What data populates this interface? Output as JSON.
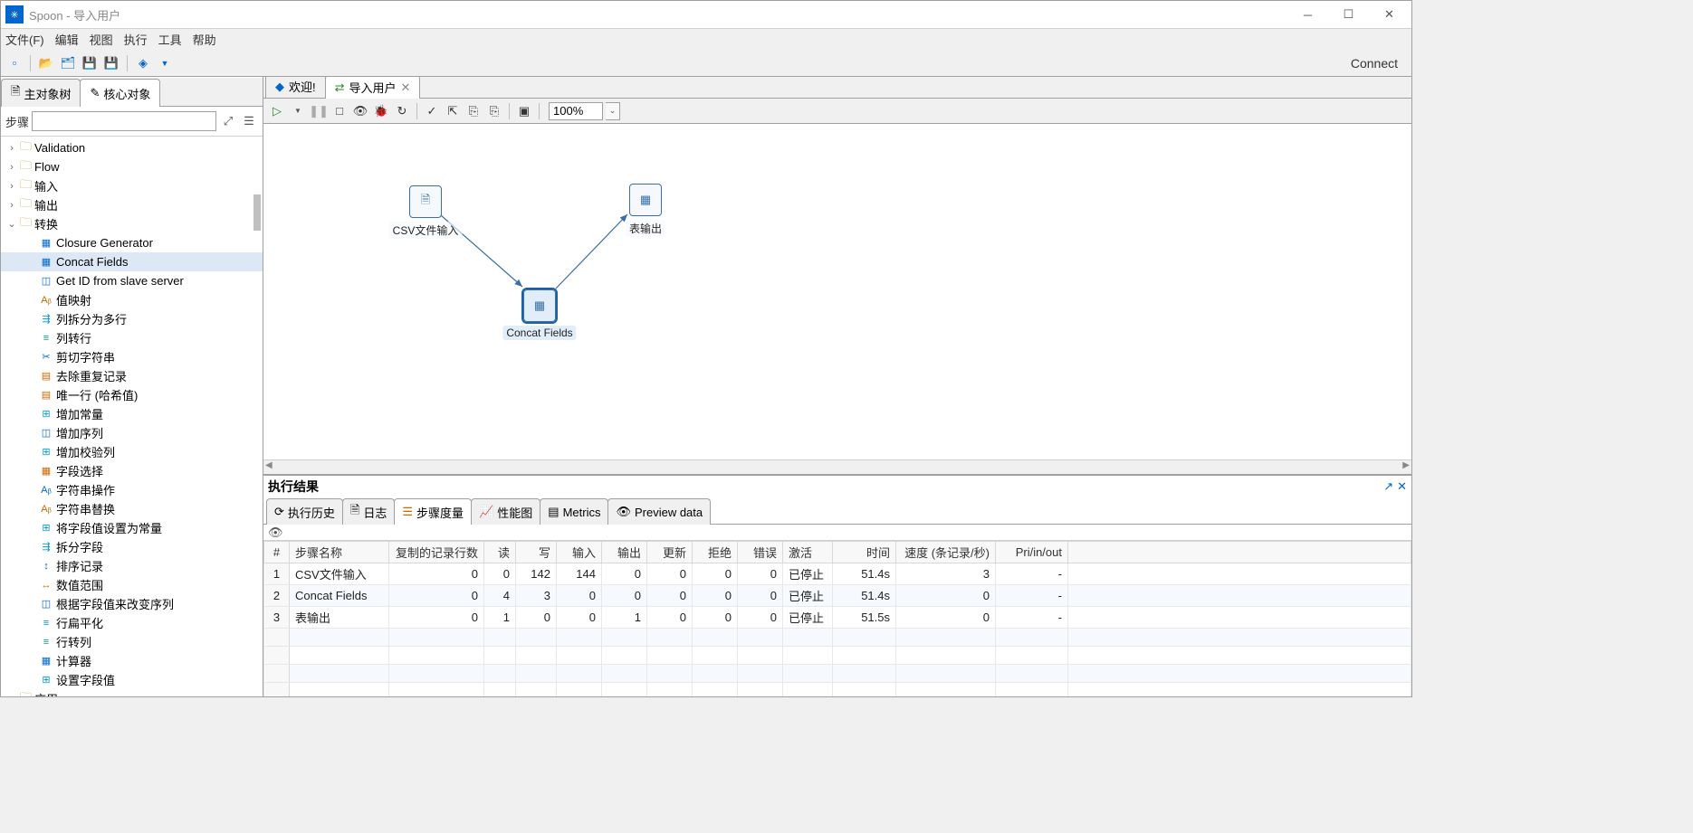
{
  "title": "Spoon - 导入用户",
  "menubar": [
    "文件(F)",
    "编辑",
    "视图",
    "执行",
    "工具",
    "帮助"
  ],
  "toolbar": {
    "connect": "Connect"
  },
  "side_tabs": {
    "main": "主对象树",
    "core": "核心对象"
  },
  "search_label": "步骤",
  "tree": {
    "validation": "Validation",
    "flow": "Flow",
    "input": "输入",
    "output": "输出",
    "transform": "转换",
    "children": [
      "Closure Generator",
      "Concat Fields",
      "Get ID from slave server",
      "值映射",
      "列拆分为多行",
      "列转行",
      "剪切字符串",
      "去除重复记录",
      "唯一行 (哈希值)",
      "增加常量",
      "增加序列",
      "增加校验列",
      "字段选择",
      "字符串操作",
      "字符串替换",
      "将字段值设置为常量",
      "拆分字段",
      "排序记录",
      "数值范围",
      "根据字段值来改变序列",
      "行扁平化",
      "行转列",
      "计算器",
      "设置字段值"
    ],
    "app": "应用"
  },
  "editor_tabs": {
    "welcome": "欢迎!",
    "import": "导入用户"
  },
  "zoom": "100%",
  "canvas": {
    "csv": "CSV文件输入",
    "concat": "Concat Fields",
    "out": "表输出"
  },
  "results": {
    "title": "执行结果",
    "tabs": {
      "hist": "执行历史",
      "log": "日志",
      "step": "步骤度量",
      "perf": "性能图",
      "metrics": "Metrics",
      "preview": "Preview data"
    },
    "cols": [
      "#",
      "步骤名称",
      "复制的记录行数",
      "读",
      "写",
      "输入",
      "输出",
      "更新",
      "拒绝",
      "错误",
      "激活",
      "时间",
      "速度 (条记录/秒)",
      "Pri/in/out"
    ],
    "rows": [
      {
        "n": "1",
        "name": "CSV文件输入",
        "copy": "0",
        "r": "0",
        "w": "142",
        "in": "144",
        "out": "0",
        "upd": "0",
        "rej": "0",
        "err": "0",
        "act": "已停止",
        "t": "51.4s",
        "spd": "3",
        "pri": "-"
      },
      {
        "n": "2",
        "name": "Concat Fields",
        "copy": "0",
        "r": "4",
        "w": "3",
        "in": "0",
        "out": "0",
        "upd": "0",
        "rej": "0",
        "err": "0",
        "act": "已停止",
        "t": "51.4s",
        "spd": "0",
        "pri": "-"
      },
      {
        "n": "3",
        "name": "表输出",
        "copy": "0",
        "r": "1",
        "w": "0",
        "in": "0",
        "out": "1",
        "upd": "0",
        "rej": "0",
        "err": "0",
        "act": "已停止",
        "t": "51.5s",
        "spd": "0",
        "pri": "-"
      }
    ]
  }
}
